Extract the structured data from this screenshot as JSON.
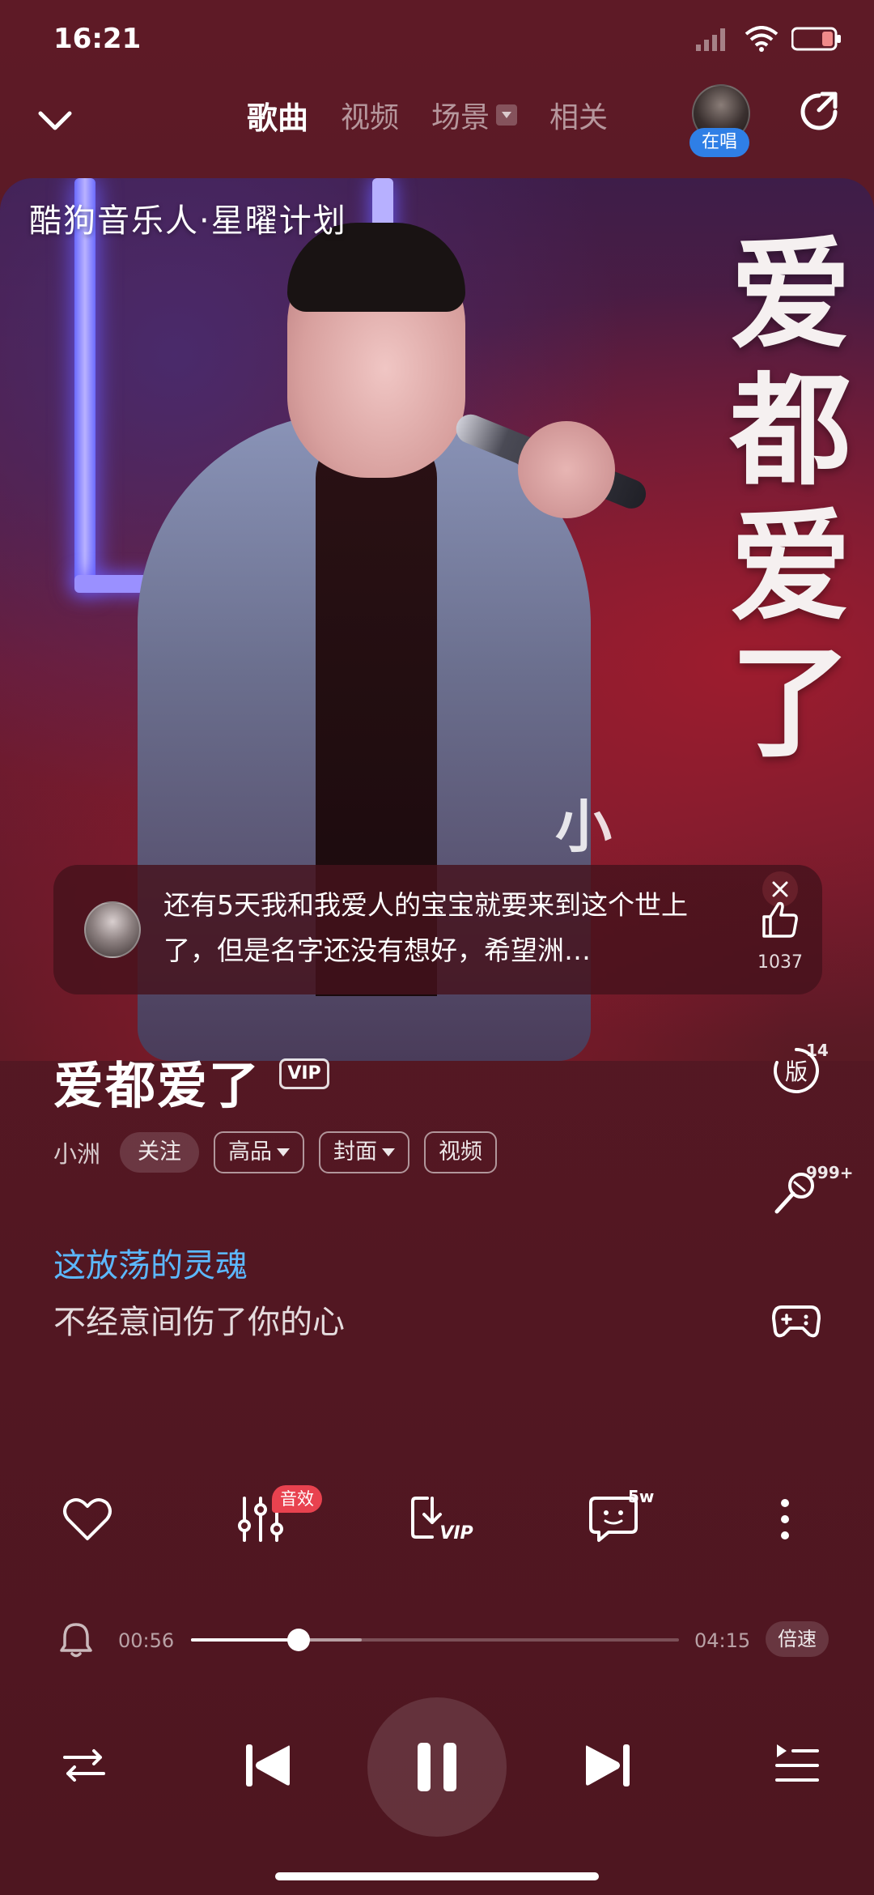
{
  "status_bar": {
    "time": "16:21"
  },
  "nav": {
    "tabs": [
      {
        "label": "歌曲",
        "active": true
      },
      {
        "label": "视频",
        "active": false
      },
      {
        "label": "场景",
        "active": false,
        "has_dropdown": true
      },
      {
        "label": "相关",
        "active": false
      }
    ],
    "avatar_badge": "在唱"
  },
  "cover": {
    "brand_text": "酷狗音乐人·星曜计划",
    "title_art_text": "爱都爱了",
    "artist_art_text": "小"
  },
  "comment": {
    "text": "还有5天我和我爱人的宝宝就要来到这个世上了，但是名字还没有想好，希望洲…",
    "like_count": "1037"
  },
  "song": {
    "title": "爱都爱了",
    "vip_badge": "VIP",
    "artist": "小洲",
    "follow_label": "关注",
    "quality_label": "高品",
    "cover_label": "封面",
    "video_label": "视频"
  },
  "side_actions": {
    "version_label": "版",
    "version_count": "14",
    "sing_count": "999+"
  },
  "lyrics": {
    "current": "这放荡的灵魂",
    "next": "不经意间伤了你的心"
  },
  "actions": {
    "effect_badge": "音效",
    "download_vip": "VIP",
    "comment_count": "5w"
  },
  "playback": {
    "current_time": "00:56",
    "total_time": "04:15",
    "progress": 0.22,
    "buffered": 0.35,
    "speed_label": "倍速"
  },
  "colors": {
    "background": "#5a1a24",
    "lyric_highlight": "#5cb8ff",
    "badge_red": "#e8424f",
    "avatar_badge_blue": "#2f7fe6"
  }
}
